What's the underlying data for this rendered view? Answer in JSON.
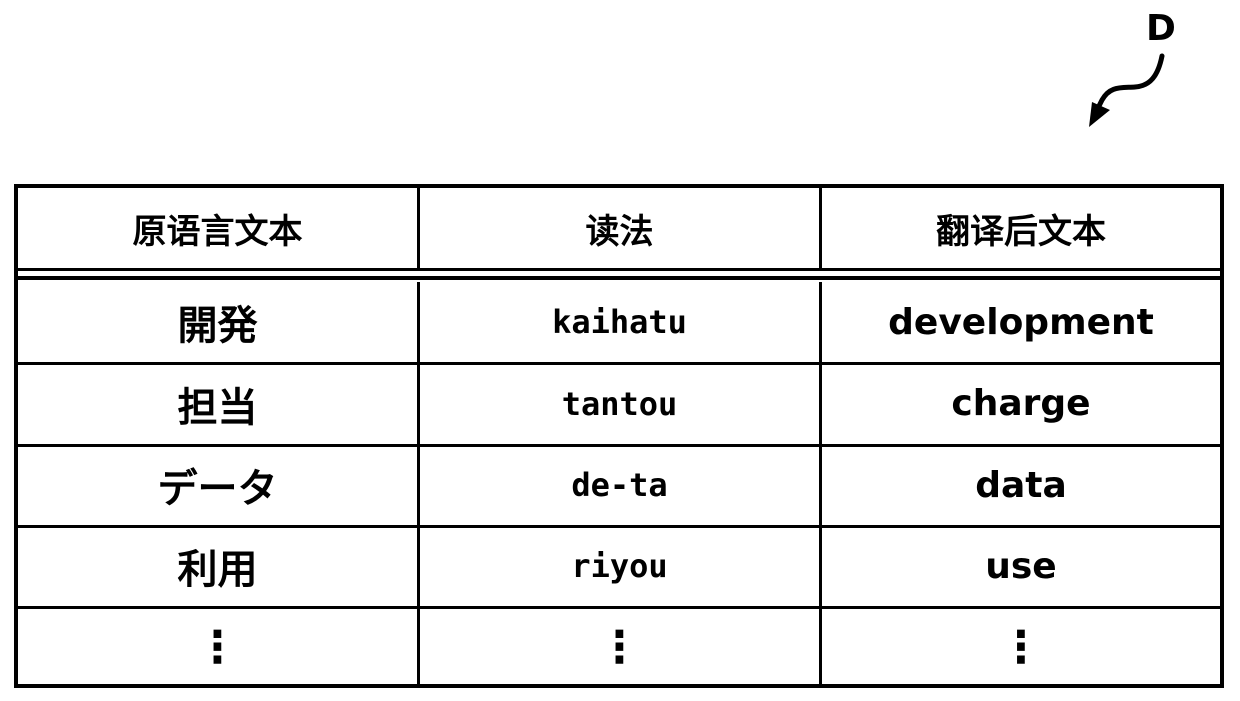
{
  "figure_label": "D",
  "table": {
    "headers": [
      "原语言文本",
      "读法",
      "翻译后文本"
    ],
    "rows": [
      [
        "開発",
        "kaihatu",
        "development"
      ],
      [
        "担当",
        "tantou",
        "charge"
      ],
      [
        "データ",
        "de-ta",
        "data"
      ],
      [
        "利用",
        "riyou",
        "use"
      ]
    ],
    "continuation": [
      "⋮",
      "⋮",
      "⋮"
    ]
  }
}
